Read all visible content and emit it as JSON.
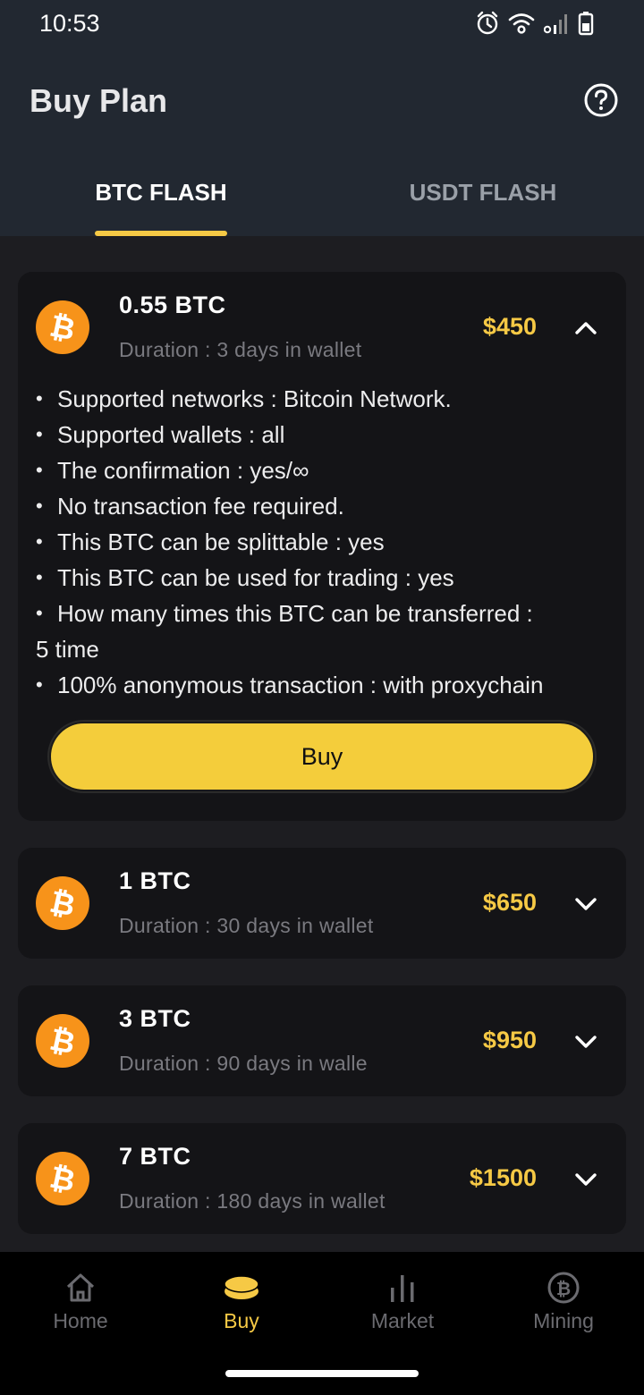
{
  "status_bar": {
    "time": "10:53"
  },
  "header": {
    "title": "Buy Plan"
  },
  "tabs": [
    {
      "label": "BTC FLASH",
      "active": true
    },
    {
      "label": "USDT FLASH",
      "active": false
    }
  ],
  "plans": [
    {
      "title": "0.55 BTC",
      "duration": "Duration : 3 days in wallet",
      "price": "$450",
      "expanded": true,
      "features": [
        "Supported networks : Bitcoin Network.",
        "Supported wallets : all",
        "The confirmation : yes/∞",
        "No transaction fee required.",
        "This BTC can be splittable : yes",
        "This BTC can be used for trading : yes",
        "How many times this BTC can be transferred :",
        "5 time",
        "100% anonymous transaction : with proxychain"
      ],
      "buy_label": "Buy"
    },
    {
      "title": "1 BTC",
      "duration": "Duration : 30 days in wallet",
      "price": "$650",
      "expanded": false
    },
    {
      "title": "3 BTC",
      "duration": "Duration : 90 days in walle",
      "price": "$950",
      "expanded": false
    },
    {
      "title": "7 BTC",
      "duration": "Duration : 180 days in wallet",
      "price": "$1500",
      "expanded": false
    }
  ],
  "bottom_nav": [
    {
      "label": "Home",
      "icon": "home-icon",
      "active": false
    },
    {
      "label": "Buy",
      "icon": "coins-icon",
      "active": true
    },
    {
      "label": "Market",
      "icon": "bar-chart-icon",
      "active": false
    },
    {
      "label": "Mining",
      "icon": "bitcoin-icon",
      "active": false
    }
  ],
  "colors": {
    "accent": "#f6c945",
    "bitcoin": "#f7931a",
    "header_bg": "#222831",
    "card_bg": "#141417",
    "page_bg": "#1d1d21"
  }
}
